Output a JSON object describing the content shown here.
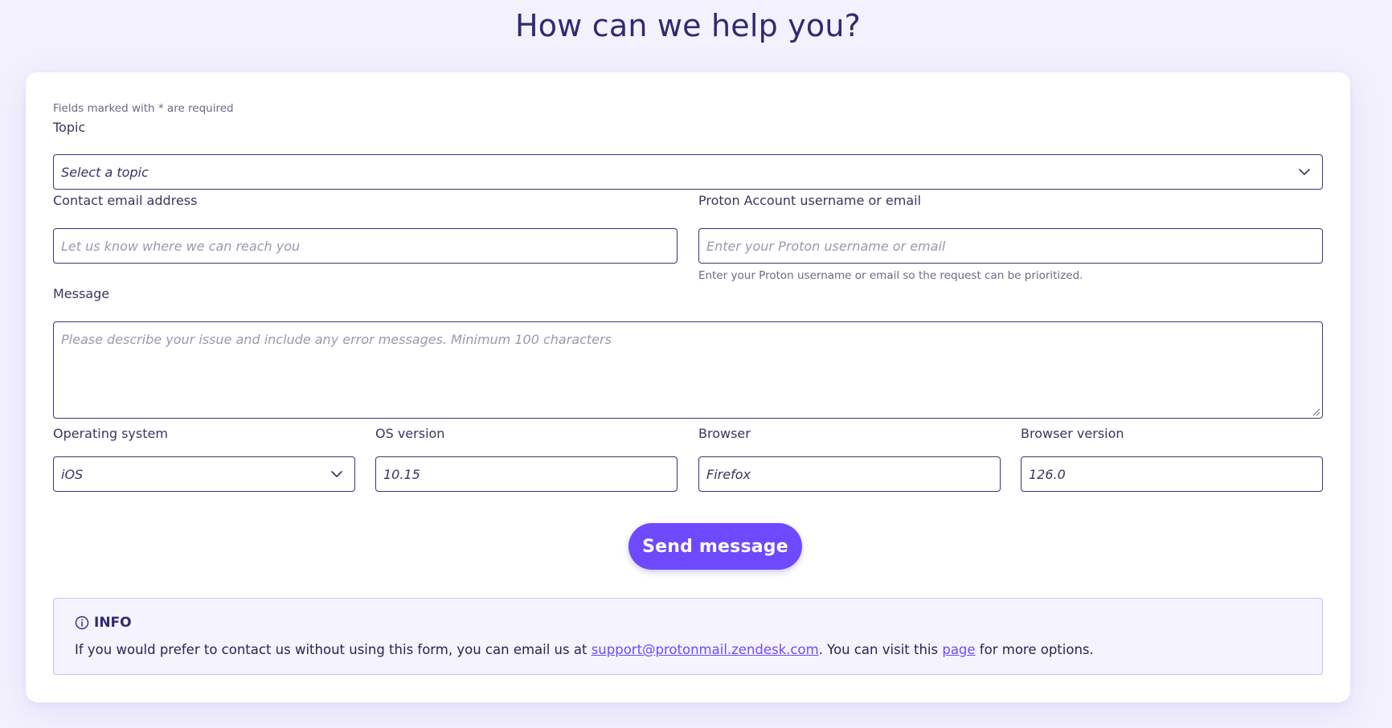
{
  "page": {
    "title": "How can we help you?"
  },
  "form": {
    "required_note": "Fields marked with * are required",
    "topic": {
      "label": "Topic",
      "placeholder": "Select a topic"
    },
    "contact_email": {
      "label": "Contact email address",
      "placeholder": "Let us know where we can reach you"
    },
    "proton_account": {
      "label": "Proton Account username or email",
      "placeholder": "Enter your Proton username or email",
      "help": "Enter your Proton username or email so the request can be prioritized."
    },
    "message": {
      "label": "Message",
      "placeholder": "Please describe your issue and include any error messages. Minimum 100 characters"
    },
    "operating_system": {
      "label": "Operating system",
      "value": "iOS"
    },
    "os_version": {
      "label": "OS version",
      "value": "10.15"
    },
    "browser": {
      "label": "Browser",
      "value": "Firefox"
    },
    "browser_version": {
      "label": "Browser version",
      "value": "126.0"
    },
    "submit_label": "Send message"
  },
  "info": {
    "heading": "INFO",
    "text_before": "If you would prefer to contact us without using this form, you can email us at ",
    "email_link": "support@protonmail.zendesk.com",
    "text_middle": ". You can visit this ",
    "page_link": "page",
    "text_after": " for more options."
  },
  "colors": {
    "accent": "#6d4aff",
    "field_border": "#3b3476",
    "page_background": "#f3f1fd",
    "title": "#2f2a72"
  },
  "icons": {
    "topic_dropdown": "chevron-down-icon",
    "os_dropdown": "chevron-down-icon",
    "info": "info-circle-icon",
    "textarea_resize": "resize-grip-icon"
  }
}
